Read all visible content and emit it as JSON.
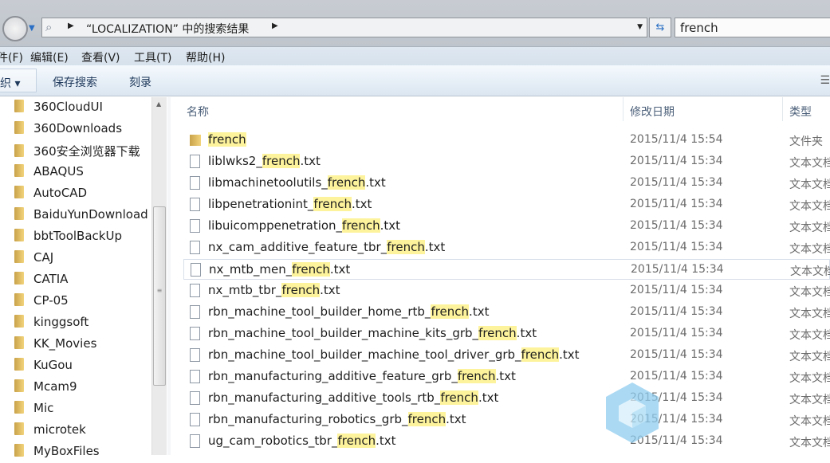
{
  "address": {
    "path": "“LOCALIZATION” 中的搜索结果"
  },
  "search": {
    "value": "french"
  },
  "menu": [
    "件(F)",
    "编辑(E)",
    "查看(V)",
    "工具(T)",
    "帮助(H)"
  ],
  "toolbar": {
    "organize": "织 ▾",
    "save_search": "保存搜索",
    "burn": "刻录"
  },
  "nav": [
    "360CloudUI",
    "360Downloads",
    "360安全浏览器下载",
    "ABAQUS",
    "AutoCAD",
    "BaiduYunDownload",
    "bbtToolBackUp",
    "CAJ",
    "CATIA",
    "CP-05",
    "kinggsoft",
    "KK_Movies",
    "KuGou",
    "Mcam9",
    "Mic",
    "microtek",
    "MyBoxFiles"
  ],
  "columns": {
    "name": "名称",
    "date": "修改日期",
    "type": "类型"
  },
  "files": [
    {
      "pre": "",
      "match": "french",
      "post": "",
      "date": "2015/11/4 15:54",
      "type": "文件夹",
      "folder": true
    },
    {
      "pre": "liblwks2_",
      "match": "french",
      "post": ".txt",
      "date": "2015/11/4 15:34",
      "type": "文本文档"
    },
    {
      "pre": "libmachinetoolutils_",
      "match": "french",
      "post": ".txt",
      "date": "2015/11/4 15:34",
      "type": "文本文档"
    },
    {
      "pre": "libpenetrationint_",
      "match": "french",
      "post": ".txt",
      "date": "2015/11/4 15:34",
      "type": "文本文档"
    },
    {
      "pre": "libuicomppenetration_",
      "match": "french",
      "post": ".txt",
      "date": "2015/11/4 15:34",
      "type": "文本文档"
    },
    {
      "pre": "nx_cam_additive_feature_tbr_",
      "match": "french",
      "post": ".txt",
      "date": "2015/11/4 15:34",
      "type": "文本文档"
    },
    {
      "pre": "nx_mtb_men_",
      "match": "french",
      "post": ".txt",
      "date": "2015/11/4 15:34",
      "type": "文本文档",
      "selected": true
    },
    {
      "pre": "nx_mtb_tbr_",
      "match": "french",
      "post": ".txt",
      "date": "2015/11/4 15:34",
      "type": "文本文档"
    },
    {
      "pre": "rbn_machine_tool_builder_home_rtb_",
      "match": "french",
      "post": ".txt",
      "date": "2015/11/4 15:34",
      "type": "文本文档"
    },
    {
      "pre": "rbn_machine_tool_builder_machine_kits_grb_",
      "match": "french",
      "post": ".txt",
      "date": "2015/11/4 15:34",
      "type": "文本文档"
    },
    {
      "pre": "rbn_machine_tool_builder_machine_tool_driver_grb_",
      "match": "french",
      "post": ".txt",
      "date": "2015/11/4 15:34",
      "type": "文本文档"
    },
    {
      "pre": "rbn_manufacturing_additive_feature_grb_",
      "match": "french",
      "post": ".txt",
      "date": "2015/11/4 15:34",
      "type": "文本文档"
    },
    {
      "pre": "rbn_manufacturing_additive_tools_rtb_",
      "match": "french",
      "post": ".txt",
      "date": "2015/11/4 15:34",
      "type": "文本文档"
    },
    {
      "pre": "rbn_manufacturing_robotics_grb_",
      "match": "french",
      "post": ".txt",
      "date": "2015/11/4 15:34",
      "type": "文本文档"
    },
    {
      "pre": "ug_cam_robotics_tbr_",
      "match": "french",
      "post": ".txt",
      "date": "2015/11/4 15:34",
      "type": "文本文档"
    }
  ],
  "colors": {
    "highlight": "#fdf39c",
    "toolbar_text": "#1e395b"
  }
}
